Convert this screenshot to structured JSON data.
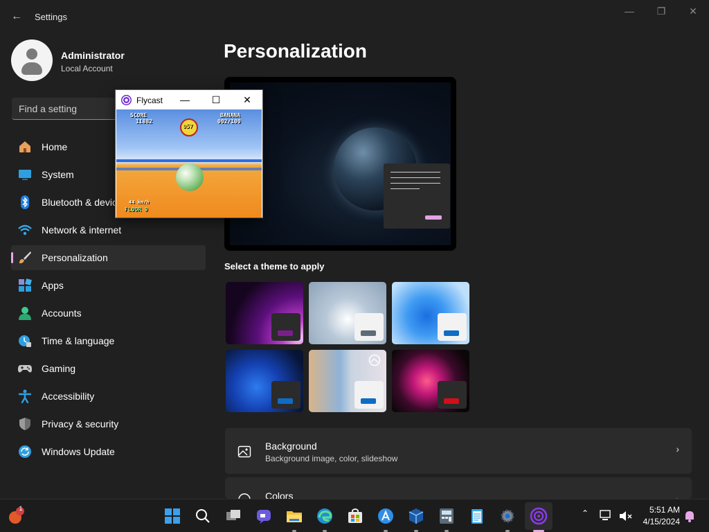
{
  "window": {
    "title": "Settings",
    "back_glyph": "←",
    "minimize_glyph": "—",
    "maximize_glyph": "❐",
    "close_glyph": "✕"
  },
  "profile": {
    "name": "Administrator",
    "account_type": "Local Account"
  },
  "search": {
    "placeholder": "Find a setting"
  },
  "nav": {
    "items": [
      {
        "label": "Home",
        "icon": "home-icon"
      },
      {
        "label": "System",
        "icon": "system-icon"
      },
      {
        "label": "Bluetooth & devices",
        "icon": "bluetooth-icon"
      },
      {
        "label": "Network & internet",
        "icon": "network-icon"
      },
      {
        "label": "Personalization",
        "icon": "brush-icon",
        "active": true
      },
      {
        "label": "Apps",
        "icon": "apps-icon"
      },
      {
        "label": "Accounts",
        "icon": "accounts-icon"
      },
      {
        "label": "Time & language",
        "icon": "time-language-icon"
      },
      {
        "label": "Gaming",
        "icon": "gaming-icon"
      },
      {
        "label": "Accessibility",
        "icon": "accessibility-icon"
      },
      {
        "label": "Privacy & security",
        "icon": "shield-icon"
      },
      {
        "label": "Windows Update",
        "icon": "update-icon"
      }
    ]
  },
  "main": {
    "title": "Personalization",
    "themes_label": "Select a theme to apply",
    "settings": [
      {
        "title": "Background",
        "subtitle": "Background image, color, slideshow",
        "icon": "image-icon"
      },
      {
        "title": "Colors",
        "subtitle": "",
        "icon": "palette-icon"
      }
    ]
  },
  "colors": {
    "accent": "#e7a8e8",
    "theme_bars": [
      "#7b1e8c",
      "#5f6b75",
      "#0f6cc4",
      "#0f6cc4",
      "#0f6cc4",
      "#d0101a"
    ]
  },
  "flycast": {
    "title": "Flycast",
    "minimize_glyph": "—",
    "maximize_glyph": "☐",
    "close_glyph": "✕",
    "game": {
      "score_label": "SCORE",
      "score_value": "11882",
      "banana_label": "BANANA",
      "banana_value": "002/100",
      "timer": "057",
      "speed": "44 km/h",
      "floor": "FLOOR 9"
    }
  },
  "taskbar": {
    "notification_badge": "1",
    "time": "5:51 AM",
    "date": "4/15/2024"
  }
}
